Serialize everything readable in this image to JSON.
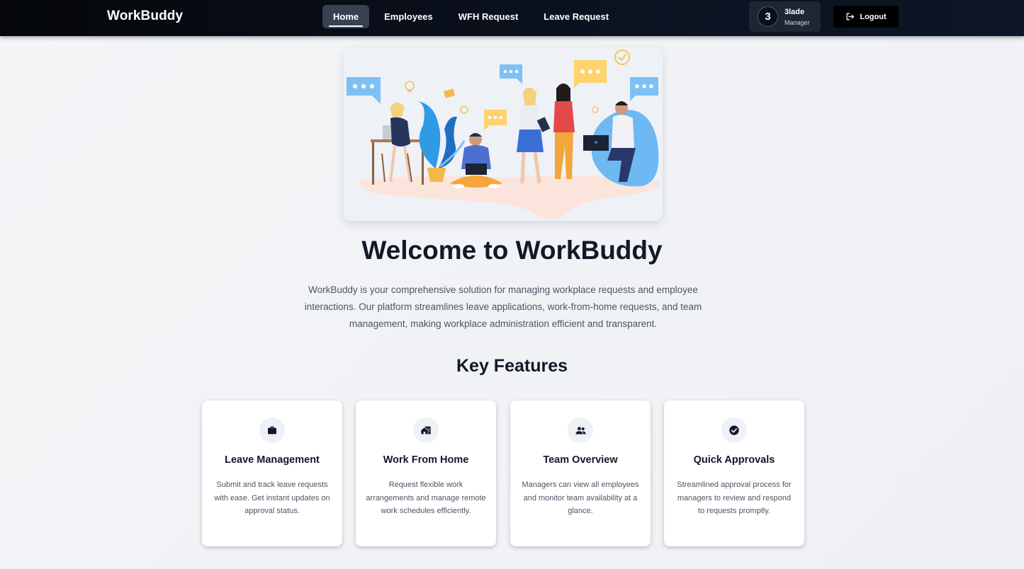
{
  "brand": "WorkBuddy",
  "nav": {
    "items": [
      {
        "label": "Home",
        "active": true
      },
      {
        "label": "Employees",
        "active": false
      },
      {
        "label": "WFH Request",
        "active": false
      },
      {
        "label": "Leave Request",
        "active": false
      }
    ]
  },
  "user": {
    "avatar_text": "3",
    "name": "3lade",
    "role": "Manager"
  },
  "logout": {
    "label": "Logout",
    "icon": "logout-icon"
  },
  "hero": {
    "illustration": "team-collaboration-illustration",
    "title": "Welcome to WorkBuddy",
    "description": "WorkBuddy is your comprehensive solution for managing workplace requests and employee interactions. Our platform streamlines leave applications, work-from-home requests, and team management, making workplace administration efficient and transparent."
  },
  "features": {
    "title": "Key Features",
    "items": [
      {
        "icon": "briefcase-icon",
        "title": "Leave Management",
        "description": "Submit and track leave requests with ease. Get instant updates on approval status."
      },
      {
        "icon": "home-work-icon",
        "title": "Work From Home",
        "description": "Request flexible work arrangements and manage remote work schedules efficiently."
      },
      {
        "icon": "people-icon",
        "title": "Team Overview",
        "description": "Managers can view all employees and monitor team availability at a glance."
      },
      {
        "icon": "check-circle-icon",
        "title": "Quick Approvals",
        "description": "Streamlined approval process for managers to review and respond to requests promptly."
      }
    ]
  },
  "colors": {
    "navbar": "#0b1220",
    "accent_dark": "#000000",
    "heading": "#111827",
    "body_text": "#4b5563"
  }
}
